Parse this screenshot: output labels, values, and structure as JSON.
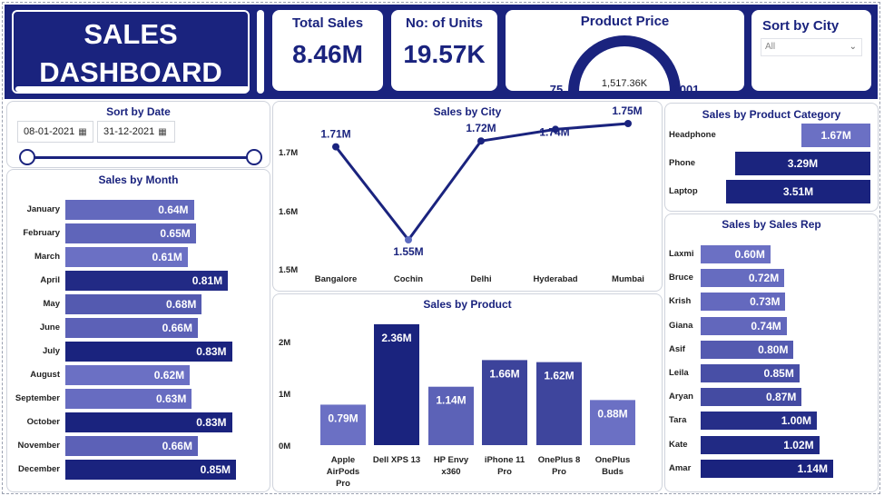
{
  "header": {
    "title_line1": "SALES",
    "title_line2": "DASHBOARD"
  },
  "kpis": {
    "total_sales_label": "Total Sales",
    "total_sales_value": "8.46M",
    "units_label": "No: of Units",
    "units_value": "19.57K",
    "price_label": "Product Price",
    "price_min": "75",
    "price_max": "2001",
    "price_value": "1,517.36K"
  },
  "city_filter": {
    "label": "Sort by City",
    "selected": "All"
  },
  "date_filter": {
    "label": "Sort by Date",
    "start": "08-01-2021",
    "end": "31-12-2021"
  },
  "colors": {
    "dark": "#1a237e",
    "mid": "#283593",
    "light": "#6b70c4"
  },
  "chart_data": [
    {
      "type": "bar",
      "title": "Sales by Month",
      "orientation": "horizontal",
      "categories": [
        "January",
        "February",
        "March",
        "April",
        "May",
        "June",
        "July",
        "August",
        "September",
        "October",
        "November",
        "December"
      ],
      "values": [
        0.64,
        0.65,
        0.61,
        0.81,
        0.68,
        0.66,
        0.83,
        0.62,
        0.63,
        0.83,
        0.66,
        0.85
      ],
      "labels": [
        "0.64M",
        "0.65M",
        "0.61M",
        "0.81M",
        "0.68M",
        "0.66M",
        "0.83M",
        "0.62M",
        "0.63M",
        "0.83M",
        "0.66M",
        "0.85M"
      ],
      "unit": "M"
    },
    {
      "type": "line",
      "title": "Sales by City",
      "categories": [
        "Bangalore",
        "Cochin",
        "Delhi",
        "Hyderabad",
        "Mumbai"
      ],
      "values": [
        1.71,
        1.55,
        1.72,
        1.74,
        1.75
      ],
      "labels": [
        "1.71M",
        "1.55M",
        "1.72M",
        "1.74M",
        "1.75M"
      ],
      "yticks": [
        "1.7M",
        "1.6M",
        "1.5M"
      ],
      "ylim": [
        1.5,
        1.75
      ]
    },
    {
      "type": "bar",
      "title": "Sales by Product",
      "categories": [
        "Apple AirPods Pro",
        "Dell XPS 13",
        "HP Envy x360",
        "iPhone 11 Pro",
        "OnePlus 8 Pro",
        "OnePlus Buds"
      ],
      "category_lines": [
        [
          "Apple",
          "AirPods",
          "Pro"
        ],
        [
          "Dell XPS 13"
        ],
        [
          "HP Envy",
          "x360"
        ],
        [
          "iPhone 11",
          "Pro"
        ],
        [
          "OnePlus 8",
          "Pro"
        ],
        [
          "OnePlus",
          "Buds"
        ]
      ],
      "values": [
        0.79,
        2.36,
        1.14,
        1.66,
        1.62,
        0.88
      ],
      "labels": [
        "0.79M",
        "2.36M",
        "1.14M",
        "1.66M",
        "1.62M",
        "0.88M"
      ],
      "yticks": [
        "2M",
        "1M",
        "0M"
      ],
      "ylim": [
        0,
        2.36
      ]
    },
    {
      "type": "bar",
      "title": "Sales by Product Category",
      "orientation": "horizontal",
      "categories": [
        "Headphone",
        "Phone",
        "Laptop"
      ],
      "values": [
        1.67,
        3.29,
        3.51
      ],
      "labels": [
        "1.67M",
        "3.29M",
        "3.51M"
      ]
    },
    {
      "type": "bar",
      "title": "Sales by Sales Rep",
      "orientation": "horizontal",
      "categories": [
        "Laxmi",
        "Bruce",
        "Krish",
        "Giana",
        "Asif",
        "Leila",
        "Aryan",
        "Tara",
        "Kate",
        "Amar"
      ],
      "values": [
        0.6,
        0.72,
        0.73,
        0.74,
        0.8,
        0.85,
        0.87,
        1.0,
        1.02,
        1.14
      ],
      "labels": [
        "0.60M",
        "0.72M",
        "0.73M",
        "0.74M",
        "0.80M",
        "0.85M",
        "0.87M",
        "1.00M",
        "1.02M",
        "1.14M"
      ]
    }
  ]
}
